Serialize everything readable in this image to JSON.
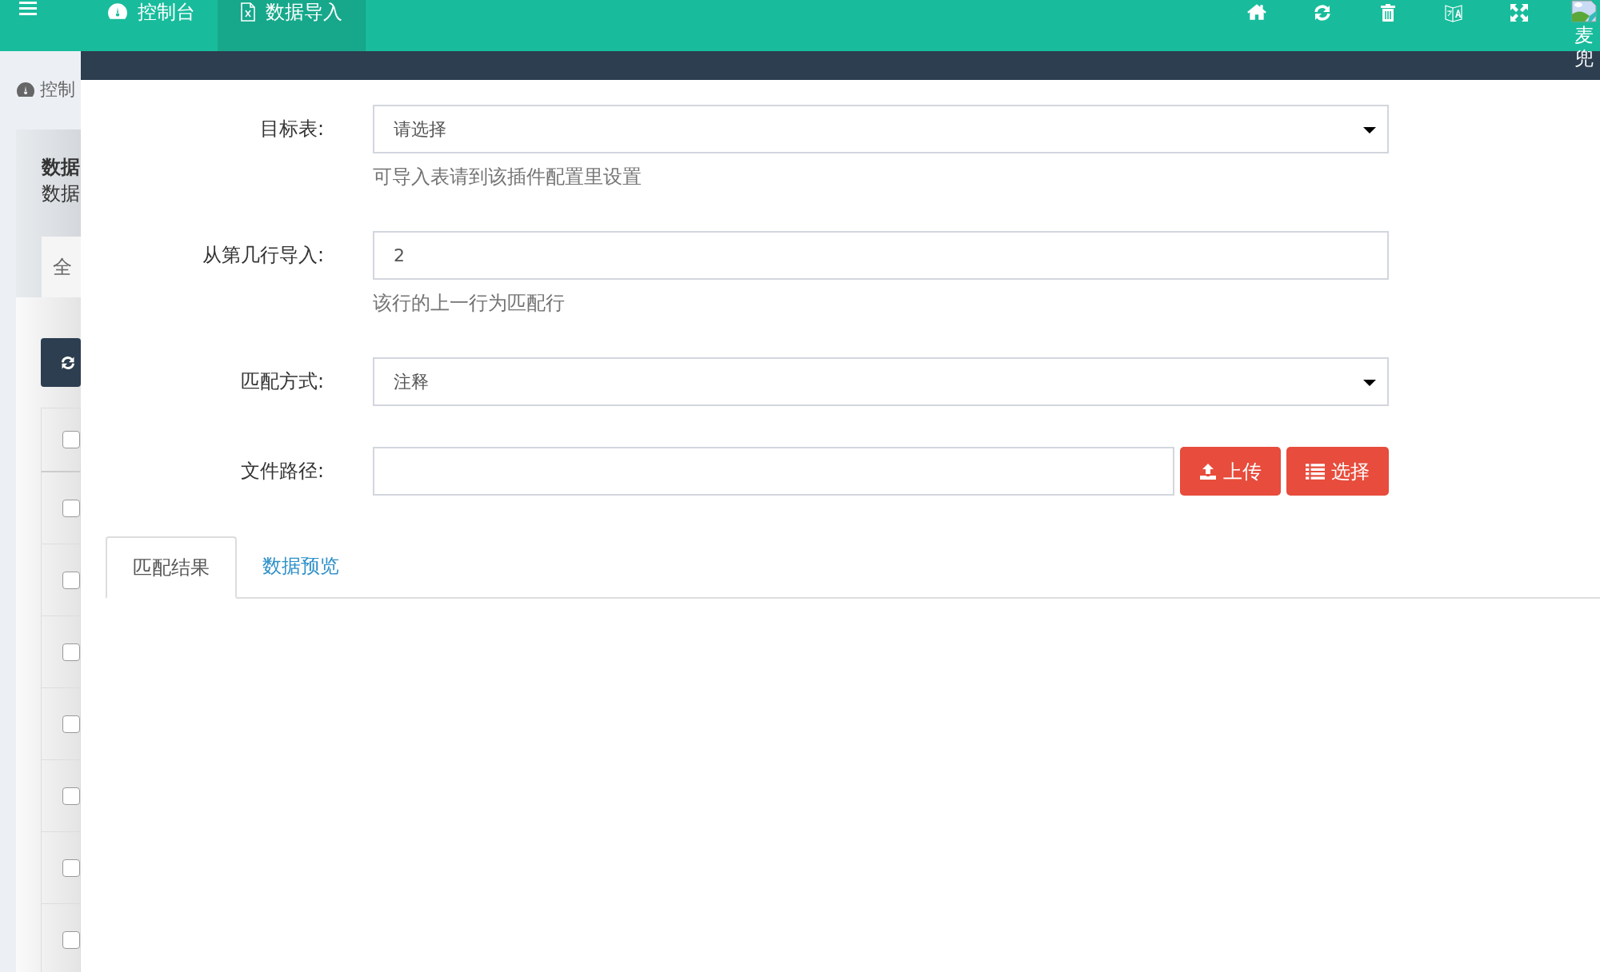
{
  "topbar": {
    "tabs": [
      {
        "label": "控制台",
        "selected": false
      },
      {
        "label": "数据导入",
        "selected": true
      }
    ],
    "user": {
      "name": "麦兜"
    }
  },
  "background_page": {
    "breadcrumb": "控制",
    "panel_title": "数据",
    "panel_subtitle": "数据",
    "tab": "全",
    "rows": [
      {
        "checked": false
      },
      {
        "checked": false
      },
      {
        "checked": false
      },
      {
        "checked": false
      },
      {
        "checked": false
      },
      {
        "checked": false
      },
      {
        "checked": false
      },
      {
        "checked": false
      }
    ]
  },
  "dialog": {
    "fields": [
      {
        "kind": "select",
        "label": "目标表:",
        "value": "请选择",
        "help": "可导入表请到该插件配置里设置"
      },
      {
        "kind": "text",
        "label": "从第几行导入:",
        "value": "2",
        "help": "该行的上一行为匹配行"
      },
      {
        "kind": "select",
        "label": "匹配方式:",
        "value": "注释"
      },
      {
        "kind": "file",
        "label": "文件路径:",
        "buttons": [
          {
            "label": "上传"
          },
          {
            "label": "选择"
          }
        ]
      }
    ],
    "tabs": [
      {
        "label": "匹配结果",
        "selected": true
      },
      {
        "label": "数据预览",
        "selected": false
      }
    ]
  }
}
